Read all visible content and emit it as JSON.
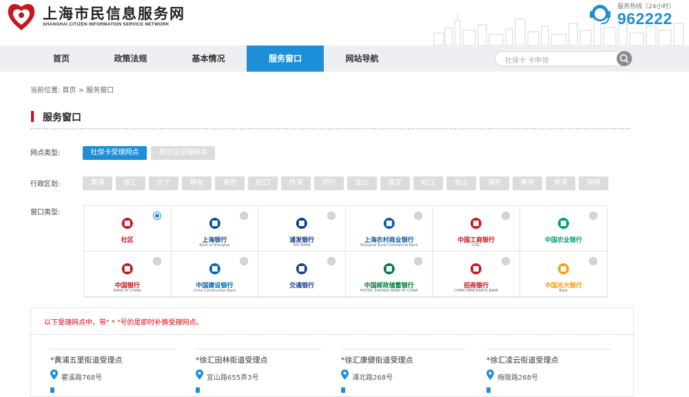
{
  "header": {
    "site_title": "上海市民信息服务网",
    "site_subtitle": "SHANGHAI CITIZEN INFORMATION SERVICE NETWORK",
    "hotline_label": "服务热线（24小时）",
    "hotline_number": "962222"
  },
  "nav": {
    "items": [
      {
        "label": "首页",
        "active": false
      },
      {
        "label": "政策法规",
        "active": false
      },
      {
        "label": "基本情况",
        "active": false
      },
      {
        "label": "服务窗口",
        "active": true
      },
      {
        "label": "网站导航",
        "active": false
      }
    ],
    "search_placeholder": "社保卡  卡申领"
  },
  "breadcrumb": "当前位置:  首页 >  服务窗口",
  "section_title": "服务窗口",
  "filters": {
    "outlet_type_label": "网点类型:",
    "outlet_types": [
      {
        "label": "社保卡受理网点",
        "selected": true
      },
      {
        "label": "居住证受理网点",
        "selected": false
      }
    ],
    "district_label": "行政区划:",
    "districts": [
      "黄浦",
      "徐汇",
      "长宁",
      "静安",
      "普陀",
      "虹口",
      "杨浦",
      "闵行",
      "宝山",
      "嘉定",
      "松江",
      "金山",
      "浦东",
      "奉贤",
      "青浦",
      "崇明"
    ],
    "window_type_label": "窗口类型:"
  },
  "banks": [
    {
      "name": "社区",
      "sub": "",
      "icon": "community-icon",
      "color": "#c8161e",
      "selected": true
    },
    {
      "name": "上海银行",
      "sub": "Bank of Shanghai",
      "icon": "bank-of-shanghai-logo",
      "color": "#0f4e9c",
      "selected": false
    },
    {
      "name": "浦发银行",
      "sub": "SPD BANK",
      "icon": "spd-bank-logo",
      "color": "#0b3b8c",
      "selected": false
    },
    {
      "name": "上海农村商业银行",
      "sub": "Shanghai Rural Commercial Bank",
      "icon": "rural-commercial-bank-logo",
      "color": "#0e5aa7",
      "selected": false
    },
    {
      "name": "中国工商银行",
      "sub": "ICBC",
      "icon": "icbc-logo",
      "color": "#c8161e",
      "selected": false
    },
    {
      "name": "中国农业银行",
      "sub": "",
      "icon": "abc-logo",
      "color": "#009b77",
      "selected": false
    },
    {
      "name": "中国银行",
      "sub": "BANK OF CHINA",
      "icon": "bank-of-china-logo",
      "color": "#b81c22",
      "selected": false
    },
    {
      "name": "中国建设银行",
      "sub": "China Construction Bank",
      "icon": "ccb-logo",
      "color": "#0066b3",
      "selected": false
    },
    {
      "name": "交通银行",
      "sub": "",
      "icon": "bocom-logo",
      "color": "#1d3f8f",
      "selected": false
    },
    {
      "name": "中国邮政储蓄银行",
      "sub": "POSTAL SAVINGS BANK OF CHINA",
      "icon": "postal-savings-logo",
      "color": "#007b40",
      "selected": false
    },
    {
      "name": "招商银行",
      "sub": "CHINA MERCHANTS BANK",
      "icon": "cmb-logo",
      "color": "#c8161e",
      "selected": false
    },
    {
      "name": "中国光大银行",
      "sub": "Bank",
      "icon": "ceb-logo",
      "color": "#f39c12",
      "selected": false
    }
  ],
  "notice": "以下受理网点中，带\" * \"号的是即时补换受理网点。",
  "points": [
    {
      "name": "*黄浦五里街道受理点",
      "address": "瞿溪路768号"
    },
    {
      "name": "*徐汇田林街道受理点",
      "address": "宜山路655弄3号"
    },
    {
      "name": "*徐汇康健街道受理点",
      "address": "浦北路268号"
    },
    {
      "name": "*徐汇凌云街道受理点",
      "address": "梅陇路268号"
    }
  ]
}
